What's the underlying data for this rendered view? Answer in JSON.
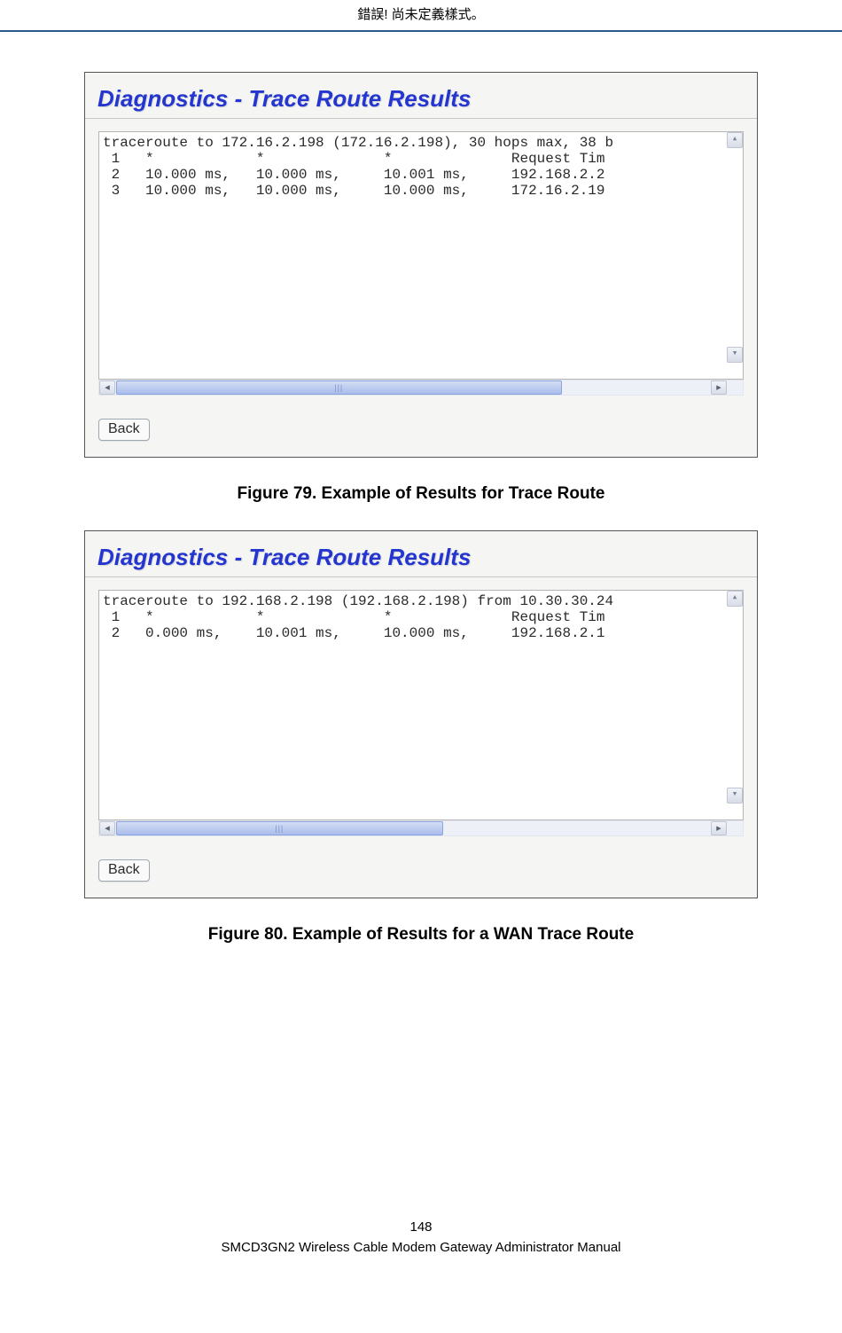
{
  "header": {
    "error_text": "錯誤! 尚未定義樣式。"
  },
  "screenshot1": {
    "panel_title": "Diagnostics - Trace Route Results",
    "output_line0": "traceroute to 172.16.2.198 (172.16.2.198), 30 hops max, 38 b",
    "output_line1": " 1   *            *              *              Request Tim",
    "output_line2": " 2   10.000 ms,   10.000 ms,     10.001 ms,     192.168.2.2",
    "output_line3": " 3   10.000 ms,   10.000 ms,     10.000 ms,     172.16.2.19",
    "back_label": "Back"
  },
  "caption1": "Figure 79. Example of Results for Trace Route",
  "screenshot2": {
    "panel_title": "Diagnostics - Trace Route Results",
    "output_line0": "traceroute to 192.168.2.198 (192.168.2.198) from 10.30.30.24",
    "output_line1": " 1   *            *              *              Request Tim",
    "output_line2": " 2   0.000 ms,    10.001 ms,     10.000 ms,     192.168.2.1",
    "back_label": "Back"
  },
  "caption2": "Figure 80. Example of Results for a WAN Trace Route",
  "footer": {
    "page_number": "148",
    "manual_title": "SMCD3GN2 Wireless Cable Modem Gateway Administrator Manual"
  }
}
